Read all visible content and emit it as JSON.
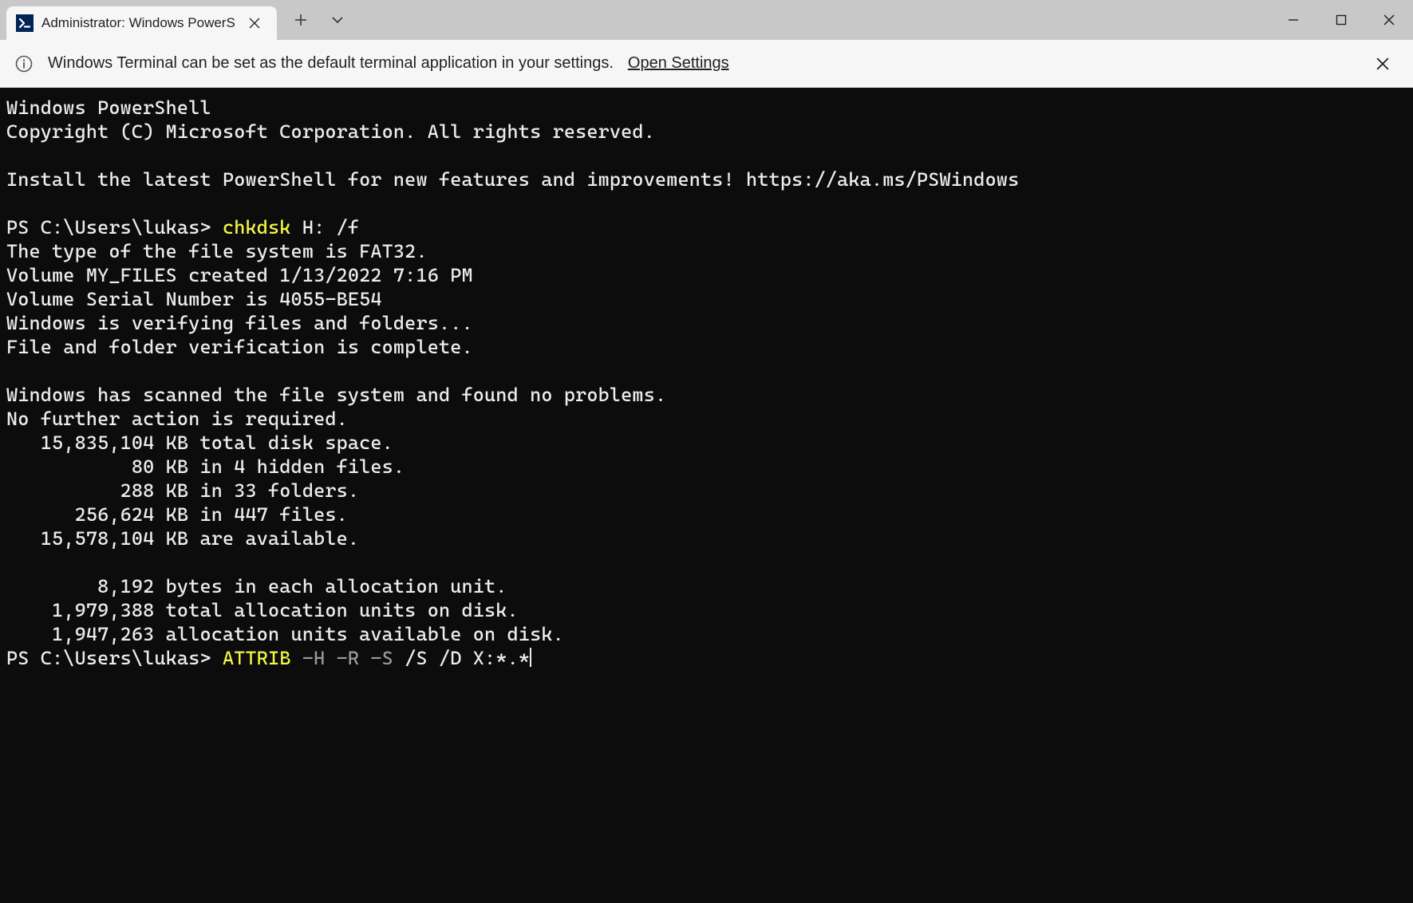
{
  "titlebar": {
    "tab_title": "Administrator: Windows PowerS",
    "icons": {
      "powershell": "powershell-icon",
      "tab_close": "close-icon",
      "new_tab": "plus-icon",
      "dropdown": "chevron-down-icon",
      "minimize": "minimize-icon",
      "maximize": "maximize-icon",
      "close": "close-icon"
    }
  },
  "infobar": {
    "text": "Windows Terminal can be set as the default terminal application in your settings.",
    "link": "Open Settings",
    "icons": {
      "info": "info-icon",
      "close": "close-icon"
    }
  },
  "terminal": {
    "lines": [
      "Windows PowerShell",
      "Copyright (C) Microsoft Corporation. All rights reserved.",
      "",
      "Install the latest PowerShell for new features and improvements! https://aka.ms/PSWindows",
      ""
    ],
    "prompt1": "PS C:\\Users\\lukas> ",
    "cmd1_name": "chkdsk",
    "cmd1_args": " H: /f",
    "output": [
      "The type of the file system is FAT32.",
      "Volume MY_FILES created 1/13/2022 7:16 PM",
      "Volume Serial Number is 4055-BE54",
      "Windows is verifying files and folders...",
      "File and folder verification is complete.",
      "",
      "Windows has scanned the file system and found no problems.",
      "No further action is required.",
      "   15,835,104 KB total disk space.",
      "           80 KB in 4 hidden files.",
      "          288 KB in 33 folders.",
      "      256,624 KB in 447 files.",
      "   15,578,104 KB are available.",
      "",
      "        8,192 bytes in each allocation unit.",
      "    1,979,388 total allocation units on disk.",
      "    1,947,263 allocation units available on disk."
    ],
    "prompt2": "PS C:\\Users\\lukas> ",
    "cmd2_name": "ATTRIB",
    "cmd2_flags": " -H -R -S",
    "cmd2_args": " /S /D X:*.*"
  }
}
